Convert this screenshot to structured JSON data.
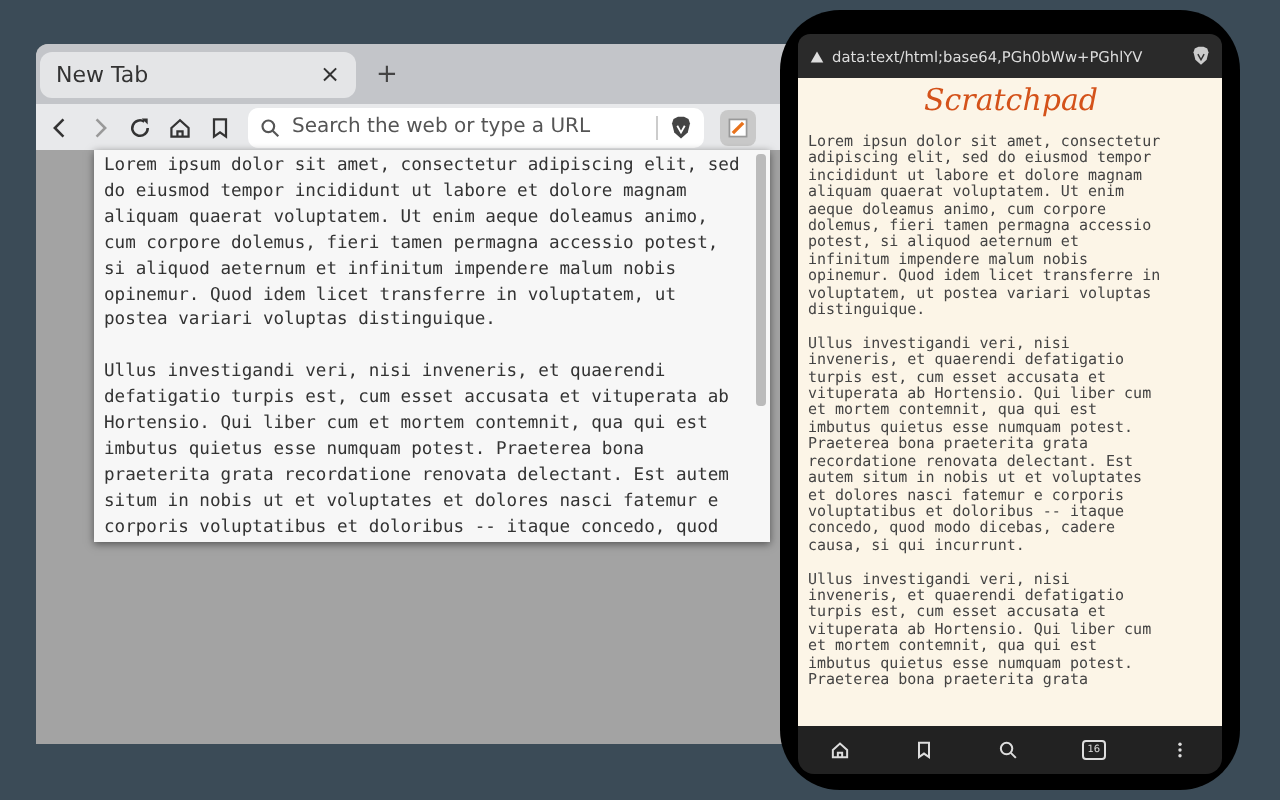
{
  "browser": {
    "tabs": [
      {
        "label": "New Tab",
        "selected": true,
        "close": "×"
      }
    ],
    "new_tab": "+",
    "toolbar": {
      "forward_disabled": true,
      "search": {
        "placeholder": "Search the web or type a URL"
      },
      "extension_active": true
    },
    "popup": {
      "paragraphs": [
        [
          "Lorem ipsum dolor sit amet, consectetur adipiscing elit, sed",
          "do eiusmod tempor incididunt ut labore et dolore magnam",
          "aliquam quaerat voluptatem. Ut enim aeque doleamus animo,",
          "cum corpore dolemus, fieri tamen permagna accessio potest,",
          "si aliquod aeternum et infinitum impendere malum nobis",
          "opinemur. Quod idem licet transferre in voluptatem, ut",
          "postea variari voluptas distinguique."
        ],
        [
          "Ullus investigandi veri, nisi inveneris, et quaerendi",
          "defatigatio turpis est, cum esset accusata et vituperata ab",
          "Hortensio. Qui liber cum et mortem contemnit, qua qui est",
          "imbutus quietus esse numquam potest. Praeterea bona",
          "praeterita grata recordatione renovata delectant. Est autem",
          "situm in nobis ut et voluptates et dolores nasci fatemur e",
          "corporis voluptatibus et doloribus -- itaque concedo, quod"
        ]
      ]
    }
  },
  "phone": {
    "url": "data:text/html;base64,PGh0bWw+PGhlYV",
    "title": "Scratchpad",
    "paragraphs": [
      [
        "Lorem ipsun dolor sit amet, consectetur",
        "adipiscing elit, sed do eiusmod tempor",
        "incididunt ut labore et dolore magnam",
        "aliquam quaerat voluptatem. Ut enim",
        "aeque doleamus animo, cum corpore",
        "dolemus, fieri tamen permagna accessio",
        "potest, si aliquod aeternum et",
        "infinitum impendere malum nobis",
        "opinemur. Quod idem licet transferre in",
        "voluptatem, ut postea variari voluptas",
        "distinguique."
      ],
      [
        "Ullus investigandi veri, nisi",
        "inveneris, et quaerendi defatigatio",
        "turpis est, cum esset accusata et",
        "vituperata ab Hortensio. Qui liber cum",
        "et mortem contemnit, qua qui est",
        "imbutus quietus esse numquam potest.",
        "Praeterea bona praeterita grata",
        "recordatione renovata delectant. Est",
        "autem situm in nobis ut et voluptates",
        "et dolores nasci fatemur e corporis",
        "voluptatibus et doloribus -- itaque",
        "concedo, quod modo dicebas, cadere",
        "causa, si qui incurrunt."
      ],
      [
        "Ullus investigandi veri, nisi",
        "inveneris, et quaerendi defatigatio",
        "turpis est, cum esset accusata et",
        "vituperata ab Hortensio. Qui liber cum",
        "et mortem contemnit, qua qui est",
        "imbutus quietus esse numquam potest.",
        "Praeterea bona praeterita grata"
      ]
    ],
    "tab_count": "16"
  }
}
